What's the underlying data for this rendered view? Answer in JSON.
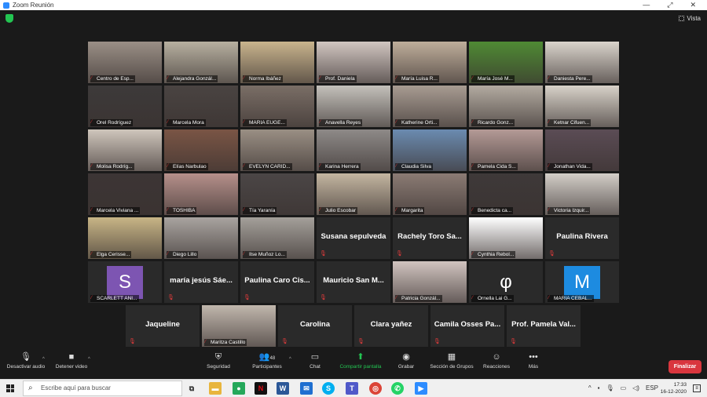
{
  "window": {
    "title": "Zoom Reunión"
  },
  "topbar": {
    "view_label": "Vista"
  },
  "tiles": [
    {
      "name": "Centro de Esp...",
      "bg": "#9a8f86"
    },
    {
      "name": "Alejandra Gonzál...",
      "bg": "#b7b0a0"
    },
    {
      "name": "Norma Ibáñez",
      "bg": "#c9b48d",
      "active": true
    },
    {
      "name": "Prof. Daniela",
      "bg": "#d1c6c1"
    },
    {
      "name": "María Luisa R...",
      "bg": "#bfae9b"
    },
    {
      "name": "María José M...",
      "bg": "#4f8a34"
    },
    {
      "name": "Daniesta Pere...",
      "bg": "#dad4cc"
    },
    {
      "name": "Orel Rodríguez",
      "bg": "#3d3a3a"
    },
    {
      "name": "Marcela Mora",
      "bg": "#4a4442"
    },
    {
      "name": "MARIA EUGE...",
      "bg": "#7a6e66"
    },
    {
      "name": "Anavella Reyes",
      "bg": "#c4c1bb"
    },
    {
      "name": "Katherine Orti...",
      "bg": "#a89c92"
    },
    {
      "name": "Ricardo Gonz...",
      "bg": "#b3aba1"
    },
    {
      "name": "Ketnar Cifuen...",
      "bg": "#d8d2c9"
    },
    {
      "name": "Molisa Rodríg...",
      "bg": "#cfc6bc"
    },
    {
      "name": "Elías Narbulao",
      "bg": "#7a5545"
    },
    {
      "name": "EVELYN CARID...",
      "bg": "#9a8f84"
    },
    {
      "name": "Karina Herrera",
      "bg": "#8e8a88"
    },
    {
      "name": "Claudia Silva",
      "bg": "#6b8bb0"
    },
    {
      "name": "Pamela Cida S...",
      "bg": "#b49a96"
    },
    {
      "name": "Jonathan Vida...",
      "bg": "#5b4c55"
    },
    {
      "name": "Marcela Viviana ...",
      "bg": "#3c3535"
    },
    {
      "name": "TOSHIBA",
      "bg": "#b6908b"
    },
    {
      "name": "Tía Yaranía",
      "bg": "#4b4646"
    },
    {
      "name": "Julio Escobar",
      "bg": "#c4b6a1"
    },
    {
      "name": "Margarita",
      "bg": "#8b7b74"
    },
    {
      "name": "Benedicta ca...",
      "bg": "#3e3939"
    },
    {
      "name": "Victoria Izquir...",
      "bg": "#d3cec8"
    },
    {
      "name": "Elga Cerisse...",
      "bg": "#c8b586"
    },
    {
      "name": "Diego Lillo",
      "bg": "#a9a4a0"
    },
    {
      "name": "Ilse Muñoz Lo...",
      "bg": "#a4a09a"
    },
    {
      "name": "Susana sepulveda",
      "text_only": true
    },
    {
      "name": "Rachely Toro Sa...",
      "text_only": true
    },
    {
      "name": "Cynthia Rebol...",
      "bg": "#ffffff"
    },
    {
      "name": "Paulina Rivera",
      "text_only": true
    },
    {
      "name": "SCARLETT ANI...",
      "avatar": "S",
      "avatar_bg": "#7d55b2"
    },
    {
      "name": "maría jesús Sáe...",
      "text_only": true
    },
    {
      "name": "Paulina Caro Cis...",
      "text_only": true
    },
    {
      "name": "Mauricio San M...",
      "text_only": true
    },
    {
      "name": "Patricia Gonzál...",
      "bg": "#d1c4c0"
    },
    {
      "name": "Ornella Lai G...",
      "avatar": "φ",
      "avatar_bg": "#2a2a2a"
    },
    {
      "name": "MARIA CEBAL...",
      "avatar": "M",
      "avatar_bg": "#1d8be0"
    },
    {
      "name": "Jaqueline",
      "text_only": true
    },
    {
      "name": "Maritza Castillo",
      "bg": "#c1b7ad"
    },
    {
      "name": "Carolina",
      "text_only": true
    },
    {
      "name": "Clara yañez",
      "text_only": true
    },
    {
      "name": "Camila Osses Pa...",
      "text_only": true
    },
    {
      "name": "Prof. Pamela Val...",
      "text_only": true
    }
  ],
  "toolbar": {
    "mute_label": "Desactivar audio",
    "video_label": "Detener video",
    "security_label": "Seguridad",
    "participants_label": "Participantes",
    "participants_count": "48",
    "chat_label": "Chat",
    "share_label": "Compartir pantalla",
    "record_label": "Grabar",
    "breakout_label": "Sección de Grupos",
    "reactions_label": "Reacciones",
    "more_label": "Más",
    "end_label": "Finalizar"
  },
  "taskbar": {
    "search_placeholder": "Escribe aquí para buscar",
    "time": "17:33",
    "date": "16-12-2020",
    "lang": "ESP"
  },
  "colors": {
    "accent_green": "#23c552",
    "end_red": "#d9363e",
    "active_border": "#d9d86a"
  }
}
